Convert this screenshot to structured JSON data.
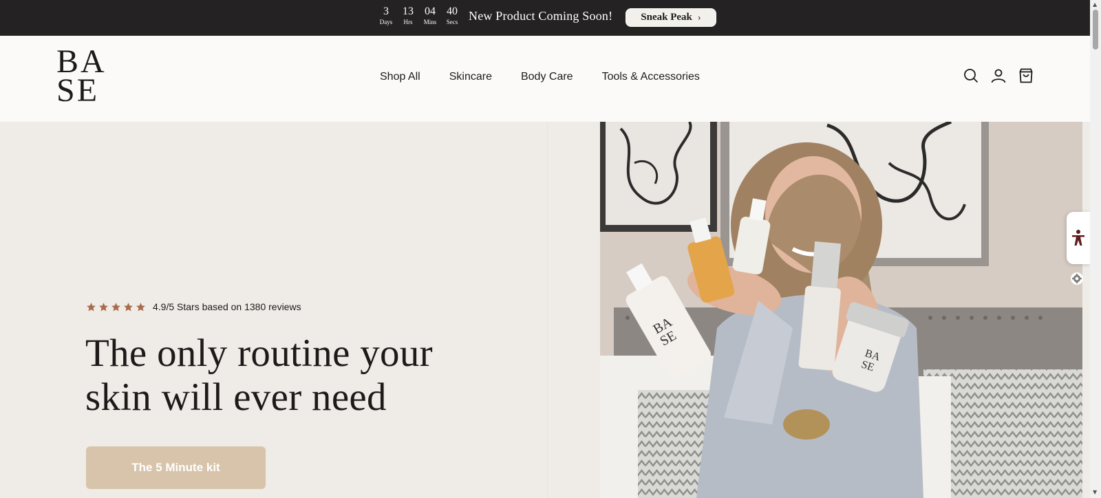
{
  "topbar": {
    "countdown": [
      {
        "value": "3",
        "label": "Days"
      },
      {
        "value": "13",
        "label": "Hrs"
      },
      {
        "value": "04",
        "label": "Mins"
      },
      {
        "value": "40",
        "label": "Secs"
      }
    ],
    "message": "New Product Coming Soon!",
    "button_label": "Sneak Peak",
    "button_icon": "chevron-right-icon"
  },
  "header": {
    "logo_line1": "BA",
    "logo_line2": "SE",
    "nav": [
      "Shop All",
      "Skincare",
      "Body Care",
      "Tools & Accessories"
    ],
    "icons": [
      "search-icon",
      "account-icon",
      "cart-icon"
    ]
  },
  "hero": {
    "rating_value": 5,
    "rating_text": "4.9/5 Stars based on 1380 reviews",
    "headline_line1": "The only routine your",
    "headline_line2": "skin will ever need",
    "cta_label": "The 5 Minute kit",
    "image_icon": "hero-video-image"
  },
  "colors": {
    "topbar_bg": "#242222",
    "header_bg": "#fbfaf8",
    "hero_bg": "#efebe7",
    "star": "#a86a4a",
    "cta_bg": "#d8c4ab",
    "accessibility_icon": "#5b1c1c"
  }
}
